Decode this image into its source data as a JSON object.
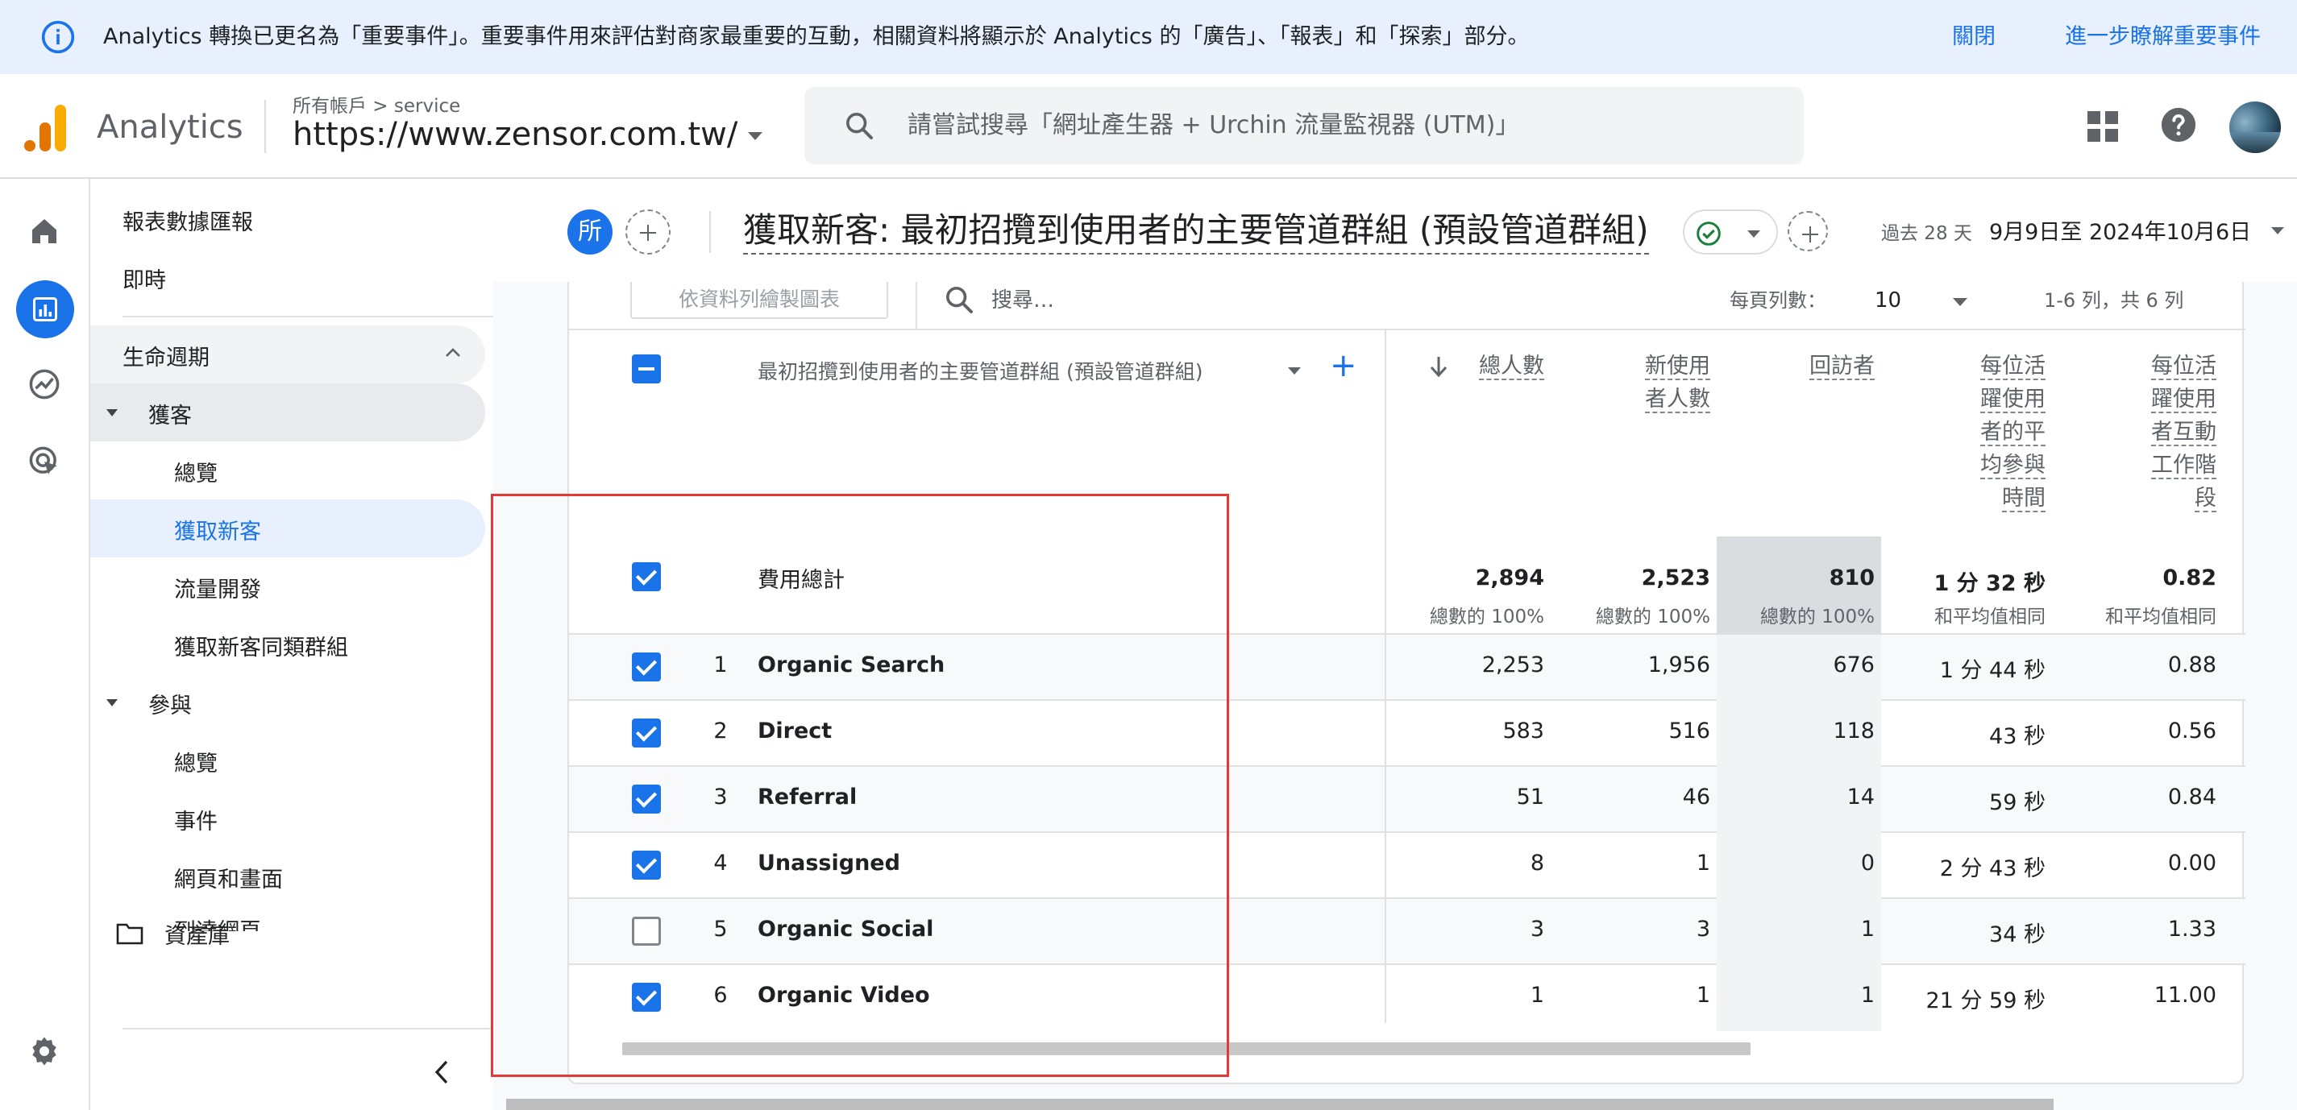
{
  "banner": {
    "message": "Analytics 轉換已更名為「重要事件」。重要事件用來評估對商家最重要的互動，相關資料將顯示於 Analytics 的「廣告」、「報表」和「探索」部分。",
    "close_label": "關閉",
    "learn_more_label": "進一步瞭解重要事件"
  },
  "header": {
    "app_name": "Analytics",
    "account_breadcrumb": "所有帳戶 > service",
    "property": "https://www.zensor.com.tw/",
    "search_placeholder": "請嘗試搜尋「網址產生器 + Urchin 流量監視器 (UTM)」"
  },
  "rail": {
    "icons": [
      "home-icon",
      "reports-icon",
      "explore-icon",
      "advertising-icon",
      "settings-icon"
    ]
  },
  "nav": {
    "snapshot": "報表數據匯報",
    "realtime": "即時",
    "lifecycle": "生命週期",
    "acquisition": "獲客",
    "acq_overview": "總覽",
    "user_acquisition": "獲取新客",
    "traffic_acquisition": "流量開發",
    "cohort": "獲取新客同類群組",
    "engagement": "參與",
    "eng_overview": "總覽",
    "events": "事件",
    "pages_screens": "網頁和畫面",
    "landing_page": "到達網頁",
    "library": "資產庫"
  },
  "report": {
    "segment_chip": "所",
    "title": "獲取新客: 最初招攬到使用者的主要管道群組 (預設管道群組)",
    "date_prefix": "過去 28 天",
    "date_range": "9月9日至 2024年10月6日"
  },
  "toolbar": {
    "plot_rows_label": "依資料列繪製圖表",
    "search_placeholder": "搜尋…",
    "rows_per_page_label": "每頁列數：",
    "rows_per_page_value": "10",
    "range_info": "1-6 列，共 6 列"
  },
  "table": {
    "dimension_header": "最初招攬到使用者的主要管道群組 (預設管道群組)",
    "metric_headers": [
      [
        "總人數"
      ],
      [
        "新使用",
        "者人數"
      ],
      [
        "回訪者"
      ],
      [
        "每位活",
        "躍使用",
        "者的平",
        "均參與",
        "時間"
      ],
      [
        "每位活",
        "躍使用",
        "者互動",
        "工作階",
        "段"
      ]
    ],
    "totals": {
      "label": "費用總計",
      "values": [
        "2,894",
        "2,523",
        "810",
        "1 分 32 秒",
        "0.82"
      ],
      "subs": [
        "總數的 100%",
        "總數的 100%",
        "總數的 100%",
        "和平均值相同",
        "和平均值相同"
      ]
    },
    "rows": [
      {
        "num": "1",
        "name": "Organic Search",
        "checked": true,
        "values": [
          "2,253",
          "1,956",
          "676",
          "1 分 44 秒",
          "0.88"
        ]
      },
      {
        "num": "2",
        "name": "Direct",
        "checked": true,
        "values": [
          "583",
          "516",
          "118",
          "43 秒",
          "0.56"
        ]
      },
      {
        "num": "3",
        "name": "Referral",
        "checked": true,
        "values": [
          "51",
          "46",
          "14",
          "59 秒",
          "0.84"
        ]
      },
      {
        "num": "4",
        "name": "Unassigned",
        "checked": true,
        "values": [
          "8",
          "1",
          "0",
          "2 分 43 秒",
          "0.00"
        ]
      },
      {
        "num": "5",
        "name": "Organic Social",
        "checked": false,
        "values": [
          "3",
          "3",
          "1",
          "34 秒",
          "1.33"
        ]
      },
      {
        "num": "6",
        "name": "Organic Video",
        "checked": true,
        "values": [
          "1",
          "1",
          "1",
          "21 分 59 秒",
          "11.00"
        ]
      }
    ]
  },
  "colors": {
    "accent": "#1a73e8",
    "banner_bg": "#e8f0fe",
    "annotation": "#e53935"
  }
}
